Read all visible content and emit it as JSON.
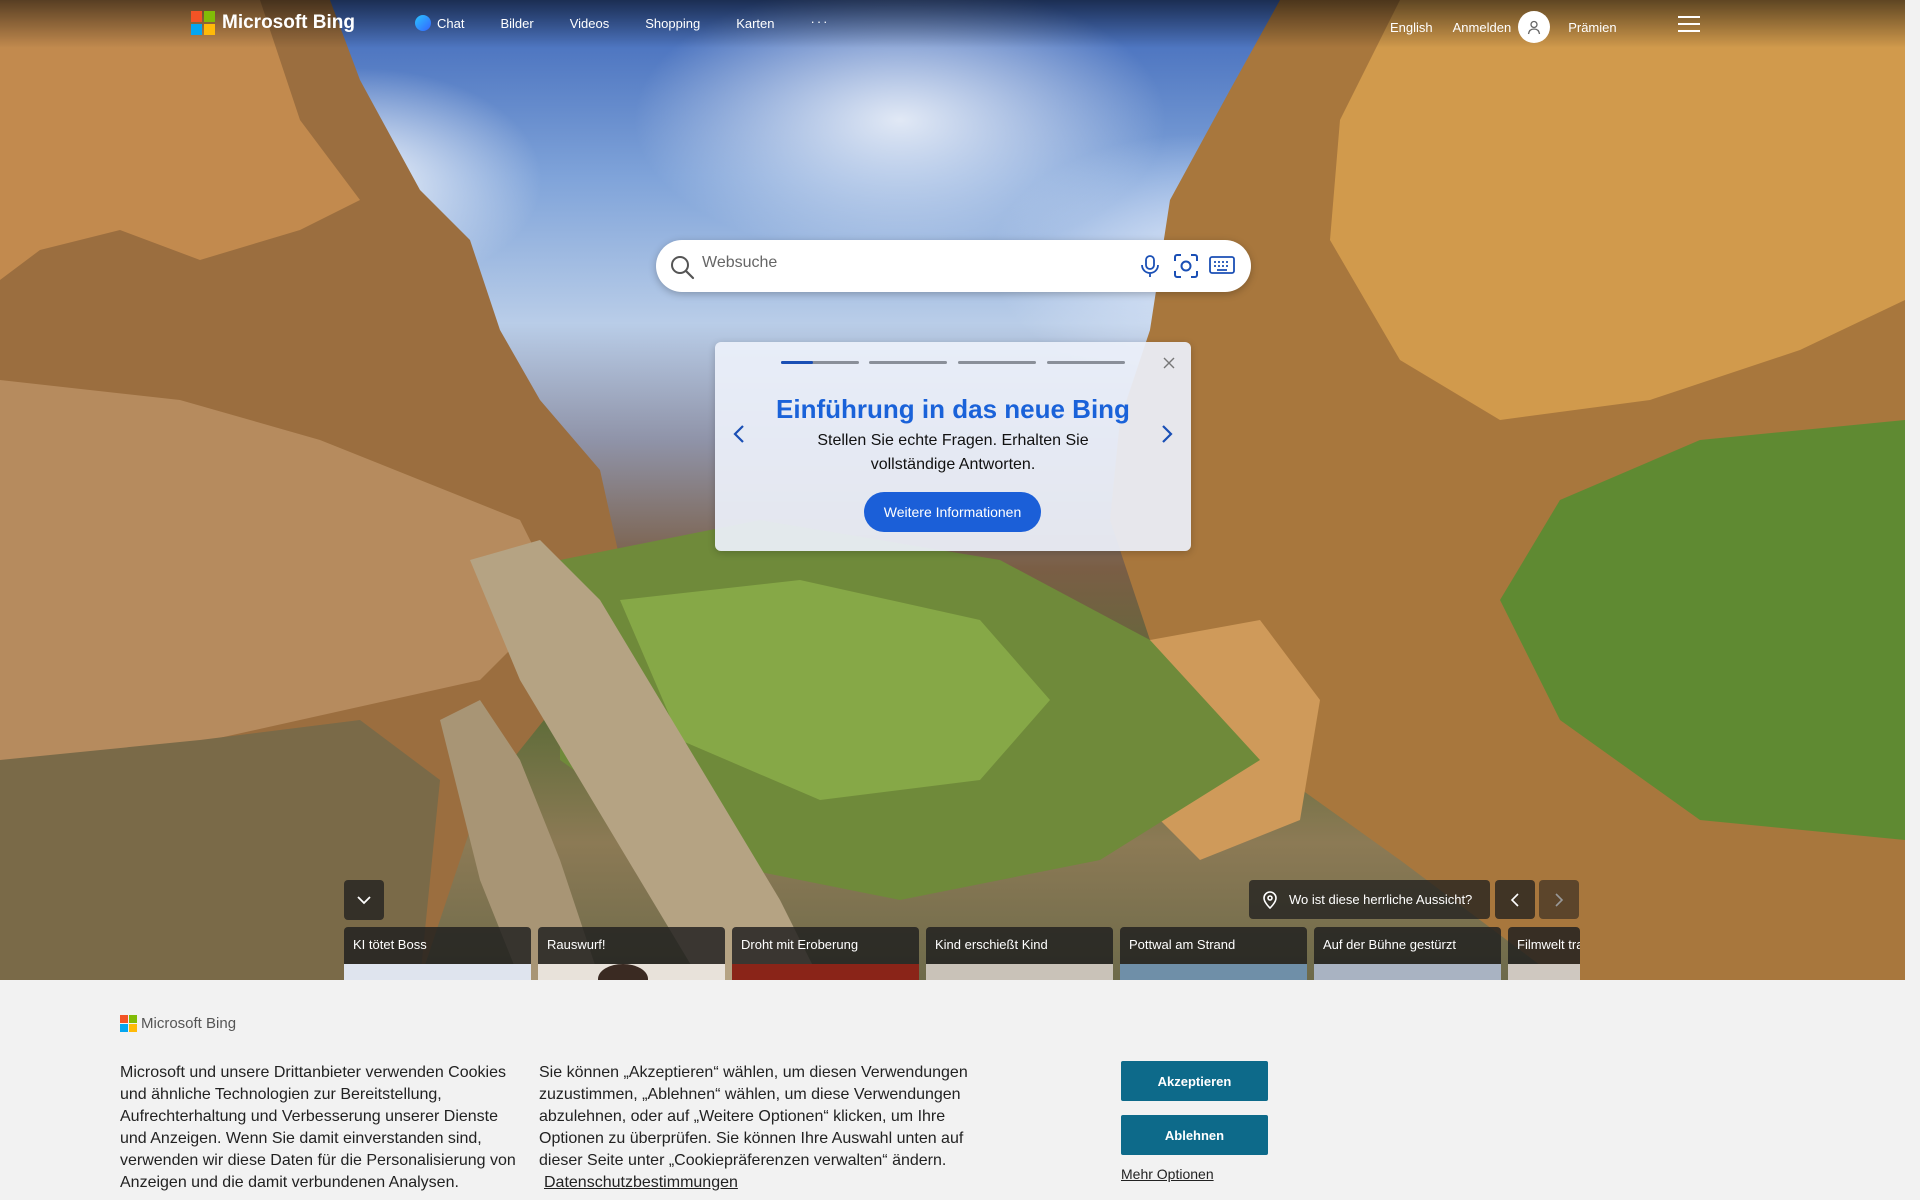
{
  "brand": {
    "name": "Microsoft Bing",
    "colors": [
      "#f35325",
      "#81bc06",
      "#05a6f0",
      "#ffba08"
    ]
  },
  "nav": {
    "items": [
      "Chat",
      "Bilder",
      "Videos",
      "Shopping",
      "Karten",
      "···"
    ],
    "language": "English",
    "signin": "Anmelden",
    "rewards": "Prämien"
  },
  "search": {
    "placeholder": "Websuche"
  },
  "promo": {
    "title": "Einführung in das neue Bing",
    "text": "Stellen Sie echte Fragen. Erhalten Sie vollständige Antworten.",
    "button": "Weitere Informationen",
    "steps": 4,
    "active_step": 1,
    "accent": "#1b5fd8"
  },
  "image_info": {
    "question": "Wo ist diese herrliche Aussicht?"
  },
  "news": [
    "KI tötet Boss",
    "Rauswurf!",
    "Droht mit Eroberung",
    "Kind erschießt Kind",
    "Pottwal am Strand",
    "Auf der Bühne gestürzt",
    "Filmwelt tra"
  ],
  "cookie": {
    "logo": "Microsoft Bing",
    "text1": "Microsoft und unsere Drittanbieter verwenden Cookies und ähnliche Technologien zur Bereitstellung, Aufrechterhaltung und Verbesserung unserer Dienste und Anzeigen. Wenn Sie damit einverstanden sind, verwenden wir diese Daten für die Personalisierung von Anzeigen und die damit verbundenen Analysen.",
    "text2": "Sie können „Akzeptieren“ wählen, um diesen Verwendungen zuzustimmen, „Ablehnen“ wählen, um diese Verwendungen abzulehnen, oder auf „Weitere Optionen“ klicken, um Ihre Optionen zu überprüfen. Sie können Ihre Auswahl unten auf dieser Seite unter „Cookiepräferenzen verwalten“ ändern.",
    "privacy": "Datenschutzbestimmungen",
    "accept": "Akzeptieren",
    "reject": "Ablehnen",
    "more": "Mehr Optionen",
    "button_color": "#0d6a8a"
  }
}
